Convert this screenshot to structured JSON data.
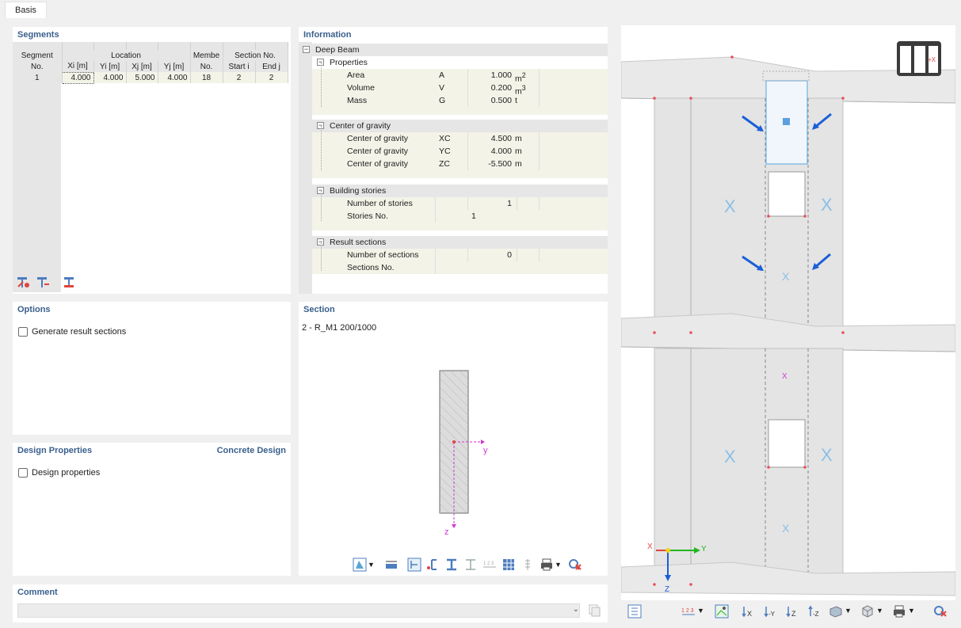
{
  "tabs": [
    "Basis"
  ],
  "segments": {
    "title": "Segments",
    "headers": {
      "segment_no_1": "Segment",
      "segment_no_2": "No.",
      "location": "Location",
      "member_1": "Membe",
      "member_2": "No.",
      "section_no": "Section No.",
      "xi": "Xi [m]",
      "yi": "Yi [m]",
      "xj": "Xj [m]",
      "yj": "Yj [m]",
      "start_i": "Start i",
      "end_j": "End j"
    },
    "rows": [
      {
        "no": "1",
        "xi": "4.000",
        "yi": "4.000",
        "xj": "5.000",
        "yj": "4.000",
        "member": "18",
        "start": "2",
        "end": "2"
      }
    ],
    "toolbar_icons": [
      "insert-row-icon",
      "delete-row-icon",
      "select-member-icon"
    ]
  },
  "information": {
    "title": "Information",
    "root": "Deep Beam",
    "groups": [
      {
        "label": "Properties",
        "items": [
          {
            "label": "Area",
            "sym": "A",
            "val": "1.000",
            "unit": "m",
            "sup": "2"
          },
          {
            "label": "Volume",
            "sym": "V",
            "val": "0.200",
            "unit": "m",
            "sup": "3"
          },
          {
            "label": "Mass",
            "sym": "G",
            "val": "0.500",
            "unit": "t",
            "sup": ""
          }
        ]
      },
      {
        "label": "Center of gravity",
        "items": [
          {
            "label": "Center of gravity",
            "sym": "XC",
            "val": "4.500",
            "unit": "m",
            "sup": ""
          },
          {
            "label": "Center of gravity",
            "sym": "YC",
            "val": "4.000",
            "unit": "m",
            "sup": ""
          },
          {
            "label": "Center of gravity",
            "sym": "ZC",
            "val": "-5.500",
            "unit": "m",
            "sup": ""
          }
        ]
      },
      {
        "label": "Building stories",
        "items": [
          {
            "label": "Number of stories",
            "sym": "",
            "val": "1",
            "unit": "",
            "sup": ""
          },
          {
            "label": "Stories No.",
            "sym": "",
            "val": "",
            "unit": "",
            "sup": "",
            "left_val": "1"
          }
        ]
      },
      {
        "label": "Result sections",
        "items": [
          {
            "label": "Number of sections",
            "sym": "",
            "val": "0",
            "unit": "",
            "sup": ""
          },
          {
            "label": "Sections No.",
            "sym": "",
            "val": "",
            "unit": "",
            "sup": ""
          }
        ]
      }
    ]
  },
  "options": {
    "title": "Options",
    "generate_label": "Generate result sections",
    "generate_checked": false
  },
  "section": {
    "title": "Section",
    "name": "2 - R_M1 200/1000",
    "axis_y": "y",
    "axis_z": "z"
  },
  "design": {
    "title": "Design Properties",
    "right_title": "Concrete Design",
    "checkbox_label": "Design properties",
    "checked": false
  },
  "comment": {
    "title": "Comment",
    "value": ""
  },
  "view3d": {
    "axis_x": "X",
    "axis_y": "Y",
    "axis_z": "Z",
    "colors": {
      "accent": "#1a5fd8",
      "selection": "#5aa0e0",
      "red": "#e8505b",
      "magenta": "#d236d2",
      "green": "#22b522"
    }
  }
}
